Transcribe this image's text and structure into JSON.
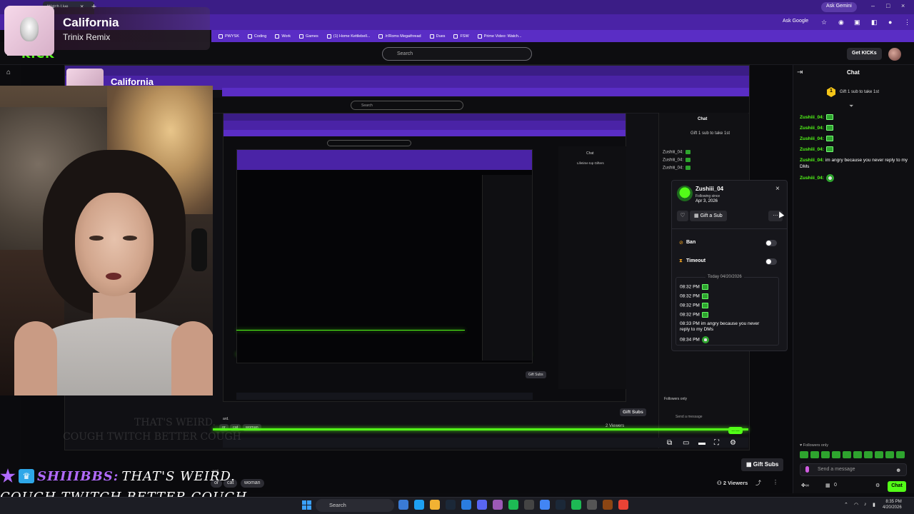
{
  "browser": {
    "tab_title": "Watch Live",
    "ask_gemini": "Ask Gemini",
    "ask_google": "Ask Google",
    "bookmarks": [
      "PWYSK",
      "Coding",
      "Work",
      "Games",
      "(1) Home Kettlebell...",
      "/r/Roms Megathread",
      "Dues",
      "FSW",
      "Prime Video: Watch..."
    ]
  },
  "kick": {
    "logo": "KICK",
    "search_placeholder": "Search",
    "get_kicks": "Get KICKs"
  },
  "now_playing": {
    "title": "California",
    "artist": "Trinix Remix"
  },
  "nested": {
    "title": "California",
    "chat_title": "Chat",
    "lifetime_gifters": "Lifetime top Gifters",
    "gift_text": "Gift 1 sub to take 1st",
    "followers_only": "Followers only",
    "send_placeholder": "Send a message",
    "chat_btn": "Chat",
    "gift_subs": "Gift Subs",
    "viewers": "2 Viewers",
    "search": "Search",
    "msg_user": "Zushiii_04:",
    "tags": [
      "or",
      "cat",
      "woman"
    ],
    "tag_text": "ard."
  },
  "popup": {
    "username": "Zushiii_04",
    "following_since_label": "Following since",
    "following_date": "Apr 3, 2026",
    "gift_sub": "Gift a Sub",
    "ban": "Ban",
    "timeout": "Timeout",
    "log_header": "Today 04/20/2026",
    "log": [
      {
        "time": "08:32 PM",
        "text": "",
        "emote": "square"
      },
      {
        "time": "08:32 PM",
        "text": "",
        "emote": "square"
      },
      {
        "time": "08:32 PM",
        "text": "",
        "emote": "square"
      },
      {
        "time": "08:32 PM",
        "text": "",
        "emote": "square"
      },
      {
        "time": "08:33 PM",
        "text": "im angry because you never",
        "text2": "reply to my DMs",
        "emote": ""
      },
      {
        "time": "08:34 PM",
        "text": "",
        "emote": "round"
      }
    ]
  },
  "chat": {
    "title": "Chat",
    "goal_number": "1",
    "goal_text": "Gift 1 sub to take 1st",
    "messages": [
      {
        "user": "Zushiii_04:",
        "text": "",
        "emote": "square"
      },
      {
        "user": "Zushiii_04:",
        "text": "",
        "emote": "square"
      },
      {
        "user": "Zushiii_04:",
        "text": "",
        "emote": "square"
      },
      {
        "user": "Zushiii_04:",
        "text": "",
        "emote": "square"
      },
      {
        "user": "Zushiii_04:",
        "text": "im angry because you never reply to my DMs",
        "emote": ""
      },
      {
        "user": "Zushiii_04:",
        "text": "",
        "emote": "round"
      }
    ],
    "followers_only": "Followers only",
    "send_placeholder": "Send a message",
    "kick_count": "0",
    "chat_button": "Chat"
  },
  "stream_info": {
    "gift_subs": "Gift Subs",
    "viewers": "2 Viewers",
    "tags": [
      "or",
      "cat",
      "woman"
    ],
    "tag_text": "ard."
  },
  "overlay_chat": {
    "ghost_line1": "THAT'S WEIRD.",
    "ghost_line2": "COUGH TWITCH BETTER COUGH",
    "username": "SHIIIBBS:",
    "message": "THAT'S WEIRD.",
    "message_line2": "COUGH TWITCH BETTER COUGH"
  },
  "taskbar": {
    "search": "Search",
    "time": "8:35 PM",
    "date": "4/20/2026"
  },
  "colors": {
    "kick_green": "#53fc18",
    "browser_purple": "#4a23a6",
    "overlay_purple": "#b26bff"
  }
}
